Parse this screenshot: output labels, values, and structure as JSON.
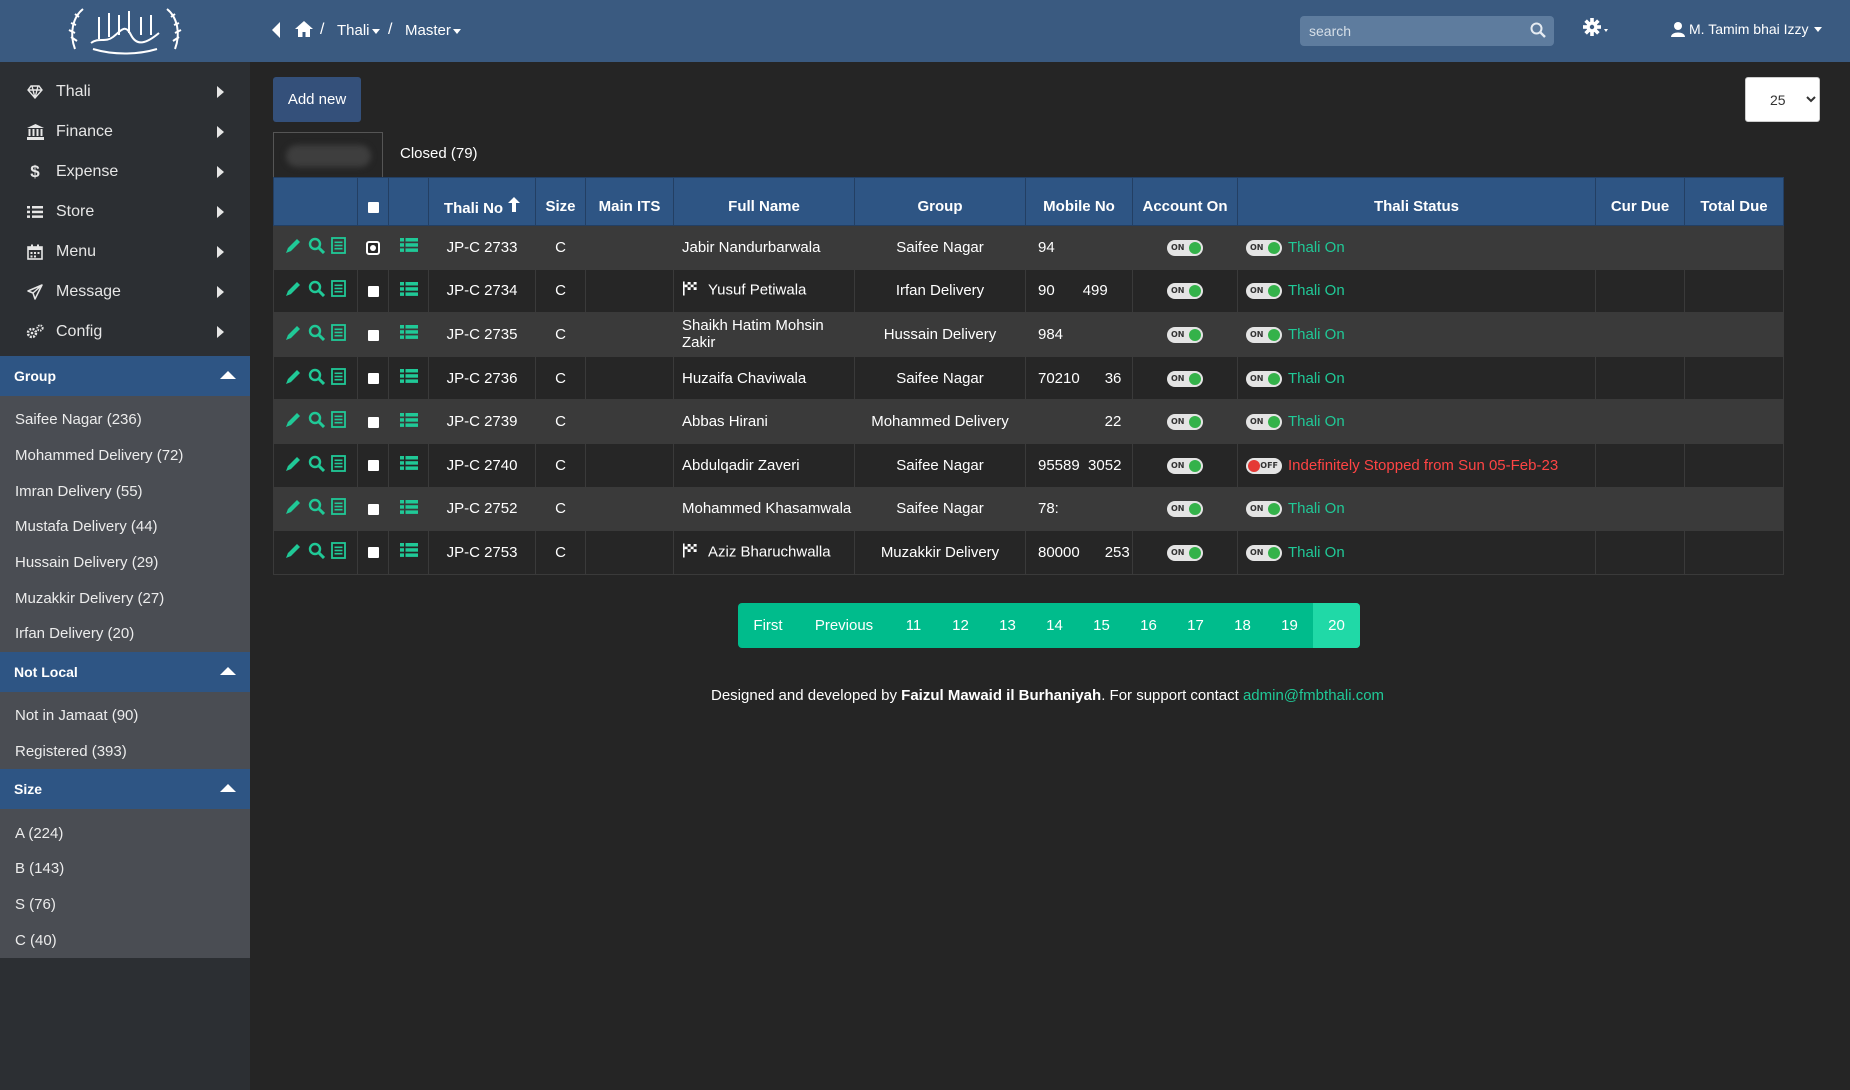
{
  "sidebar": {
    "nav": [
      {
        "label": "Thali",
        "icon": "diamond-icon"
      },
      {
        "label": "Finance",
        "icon": "bank-icon"
      },
      {
        "label": "Expense",
        "icon": "dollar-icon"
      },
      {
        "label": "Store",
        "icon": "list-icon"
      },
      {
        "label": "Menu",
        "icon": "calendar-icon"
      },
      {
        "label": "Message",
        "icon": "send-icon"
      },
      {
        "label": "Config",
        "icon": "gears-icon"
      }
    ],
    "filters": [
      {
        "title": "Group",
        "items": [
          "Saifee Nagar (236)",
          "Mohammed Delivery (72)",
          "Imran Delivery (55)",
          "Mustafa Delivery (44)",
          "Hussain Delivery (29)",
          "Muzakkir Delivery (27)",
          "Irfan Delivery (20)"
        ]
      },
      {
        "title": "Not Local",
        "items": [
          "Not in Jamaat (90)",
          "Registered (393)"
        ]
      },
      {
        "title": "Size",
        "items": [
          "A (224)",
          "B (143)",
          "S (76)",
          "C (40)"
        ]
      }
    ]
  },
  "topbar": {
    "breadcrumb": [
      "Thali",
      "Master"
    ],
    "separator": "/",
    "search_placeholder": "search",
    "user": "M. Tamim bhai Izzy"
  },
  "toolbar": {
    "add_new": "Add new",
    "page_size": "25",
    "tab_closed": "Closed (79)"
  },
  "table": {
    "columns": [
      "",
      "",
      "",
      "Thali No",
      "Size",
      "Main ITS",
      "Full Name",
      "Group",
      "Mobile No",
      "Account On",
      "Thali Status",
      "Cur Due",
      "Total Due"
    ],
    "rows": [
      {
        "thali": "JP-C 2733",
        "size": "C",
        "its": "",
        "name": "Jabir Nandurbarwala",
        "flag": false,
        "group": "Saifee Nagar",
        "mobile": "94",
        "account": "ON",
        "status": "Thali On",
        "status_on": true,
        "selected": true
      },
      {
        "thali": "JP-C 2734",
        "size": "C",
        "its": "",
        "name": "Yusuf Petiwala",
        "flag": true,
        "group": "Irfan Delivery",
        "mobile": "90       499",
        "account": "ON",
        "status": "Thali On",
        "status_on": true,
        "selected": false
      },
      {
        "thali": "JP-C 2735",
        "size": "C",
        "its": "",
        "name": "Shaikh Hatim Mohsin Zakir",
        "flag": false,
        "group": "Hussain Delivery",
        "mobile": "984",
        "account": "ON",
        "status": "Thali On",
        "status_on": true,
        "selected": false
      },
      {
        "thali": "JP-C 2736",
        "size": "C",
        "its": "",
        "name": "Huzaifa Chaviwala",
        "flag": false,
        "group": "Saifee Nagar",
        "mobile": "70210      36",
        "account": "ON",
        "status": "Thali On",
        "status_on": true,
        "selected": false
      },
      {
        "thali": "JP-C 2739",
        "size": "C",
        "its": "",
        "name": "Abbas Hirani",
        "flag": false,
        "group": "Mohammed Delivery",
        "mobile": "                22",
        "account": "ON",
        "status": "Thali On",
        "status_on": true,
        "selected": false
      },
      {
        "thali": "JP-C 2740",
        "size": "C",
        "its": "",
        "name": "Abdulqadir Zaveri",
        "flag": false,
        "group": "Saifee Nagar",
        "mobile": "95589  3052",
        "account": "ON",
        "status": "Indefinitely Stopped from Sun 05-Feb-23",
        "status_on": false,
        "selected": false
      },
      {
        "thali": "JP-C 2752",
        "size": "C",
        "its": "",
        "name": "Mohammed Khasamwala",
        "flag": false,
        "group": "Saifee Nagar",
        "mobile": "78:",
        "account": "ON",
        "status": "Thali On",
        "status_on": true,
        "selected": false
      },
      {
        "thali": "JP-C 2753",
        "size": "C",
        "its": "",
        "name": "Aziz Bharuchwalla",
        "flag": true,
        "group": "Muzakkir Delivery",
        "mobile": "80000      253",
        "account": "ON",
        "status": "Thali On",
        "status_on": true,
        "selected": false
      }
    ]
  },
  "pagination": {
    "items": [
      "First",
      "Previous",
      "11",
      "12",
      "13",
      "14",
      "15",
      "16",
      "17",
      "18",
      "19",
      "20"
    ],
    "active": "20"
  },
  "footer": {
    "prefix": "Designed and developed by ",
    "org": "Faizul Mawaid il Burhaniyah",
    "middle": ". For support contact ",
    "email": "admin@fmbthali.com"
  },
  "colors": {
    "accent": "#00bc8c",
    "header": "#2e5584",
    "topbar": "#3a5a80",
    "status_on": "#20c997",
    "status_off": "#ff4444"
  }
}
